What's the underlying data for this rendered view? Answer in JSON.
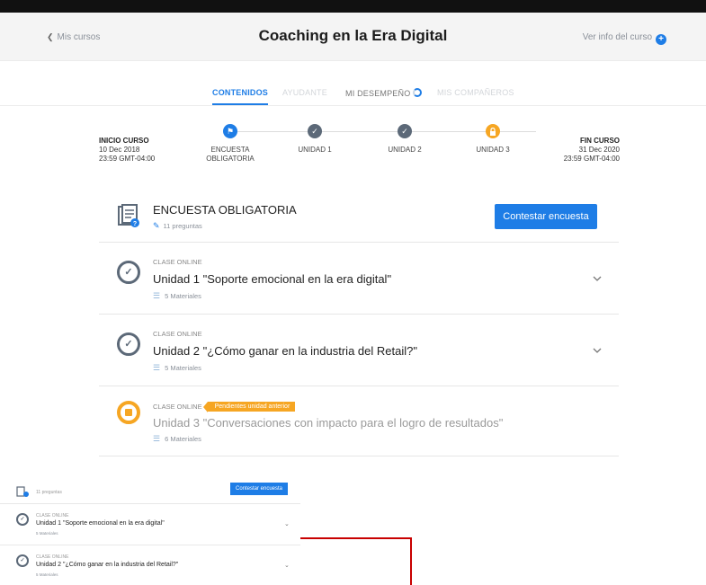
{
  "header": {
    "back_label": "Mis cursos",
    "title": "Coaching en la Era Digital",
    "info_label": "Ver info del curso"
  },
  "tabs": [
    {
      "label": "CONTENIDOS",
      "state": "active"
    },
    {
      "label": "AYUDANTE",
      "state": "disabled"
    },
    {
      "label": "MI DESEMPEÑO",
      "state": "normal"
    },
    {
      "label": "MIS COMPAÑEROS",
      "state": "disabled"
    }
  ],
  "timeline": {
    "start": {
      "label": "INICIO CURSO",
      "date": "10 Dec 2018",
      "time": "23:59 GMT-04:00"
    },
    "end": {
      "label": "FIN CURSO",
      "date": "31 Dec 2020",
      "time": "23:59 GMT-04:00"
    },
    "steps": [
      {
        "label_1": "ENCUESTA",
        "label_2": "OBLIGATORIA",
        "status": "current",
        "color": "#1e7de6"
      },
      {
        "label_1": "UNIDAD 1",
        "label_2": "",
        "status": "done",
        "color": "#5c6978"
      },
      {
        "label_1": "UNIDAD 2",
        "label_2": "",
        "status": "done",
        "color": "#5c6978"
      },
      {
        "label_1": "UNIDAD 3",
        "label_2": "",
        "status": "locked",
        "color": "#f6a623"
      }
    ]
  },
  "survey": {
    "title": "ENCUESTA OBLIGATORIA",
    "subtitle": "11 preguntas",
    "button_label": "Contestar encuesta"
  },
  "units": [
    {
      "kicker": "CLASE ONLINE",
      "title": "Unidad 1 \"Soporte emocional en la era digital\"",
      "materials": "5 Materiales",
      "status": "done"
    },
    {
      "kicker": "CLASE ONLINE",
      "title": "Unidad 2 \"¿Cómo ganar en la industria del Retail?\"",
      "materials": "5 Materiales",
      "status": "done"
    },
    {
      "kicker": "CLASE ONLINE",
      "badge": "Pendientes unidad anterior",
      "title": "Unidad 3 \"Conversaciones con impacto para el logro de resultados\"",
      "materials": "6 Materiales",
      "status": "locked"
    }
  ],
  "mini": {
    "survey_subtitle": "11 preguntas",
    "button_label": "Contestar encuesta",
    "units": [
      {
        "kicker": "CLASE ONLINE",
        "title": "Unidad 1 \"Soporte emocional en la era digital\"",
        "materials": "5 Materiales"
      },
      {
        "kicker": "CLASE ONLINE",
        "title": "Unidad 2 \"¿Cómo ganar en la industria del Retail?\"",
        "materials": "5 Materiales"
      }
    ]
  },
  "colors": {
    "accent": "#1e7de6",
    "done": "#5c6978",
    "locked": "#f6a623",
    "annotation": "#c80000"
  }
}
